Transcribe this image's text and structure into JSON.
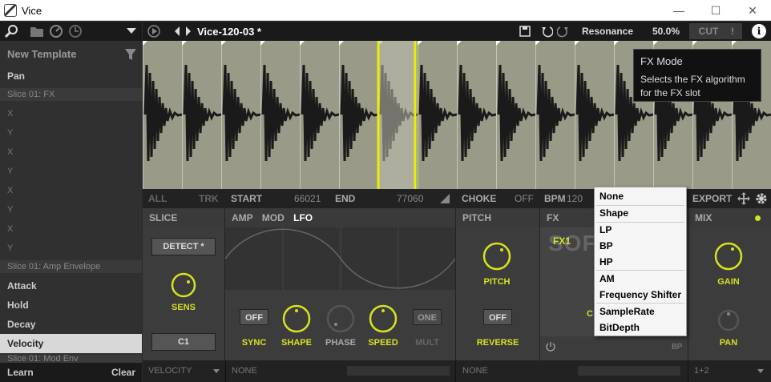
{
  "window": {
    "title": "Vice",
    "min": "—",
    "max": "☐",
    "close": "✕"
  },
  "sidebar": {
    "template": "New Template",
    "pan": "Pan",
    "sec1": "Slice 01: FX",
    "xy": [
      "X",
      "Y",
      "X",
      "Y",
      "X",
      "Y",
      "X",
      "Y"
    ],
    "sec2": "Slice 01: Amp Envelope",
    "env": [
      "Attack",
      "Hold",
      "Decay",
      "Velocity"
    ],
    "sec3": "Slice 01: Mod Env",
    "learn": "Learn",
    "clear": "Clear"
  },
  "topbar": {
    "preset": "Vice-120-03 *",
    "param": "Resonance",
    "value": "50.0%",
    "cut": "CUT",
    "excl": "!",
    "info": "i"
  },
  "ctrlbar": {
    "all": "ALL",
    "trk": "TRK",
    "start": "START",
    "start_val": "66021",
    "end": "END",
    "end_val": "77060",
    "choke": "CHOKE",
    "choke_val": "OFF",
    "bpm": "BPM",
    "bpm_val": "120",
    "export": "EXPORT"
  },
  "panels": {
    "slice": {
      "title": "SLICE",
      "detect": "DETECT *",
      "sens": "SENS",
      "note": "C1"
    },
    "amp": {
      "amp": "AMP",
      "mod": "MOD",
      "lfo": "LFO",
      "sync_btn": "OFF",
      "one": "ONE",
      "sync": "SYNC",
      "shape": "SHAPE",
      "phase": "PHASE",
      "speed": "SPEED",
      "mult": "MULT"
    },
    "pitch": {
      "title": "PITCH",
      "pitch": "PITCH",
      "rev_btn": "OFF",
      "reverse": "REVERSE"
    },
    "fx": {
      "title": "FX",
      "fx1": "FX1",
      "c": "C",
      "bp": "BP"
    },
    "mix": {
      "title": "MIX",
      "gain": "GAIN",
      "pan": "PAN"
    }
  },
  "footer": {
    "velocity": "VELOCITY",
    "none1": "NONE",
    "none2": "NONE",
    "route": "1+2"
  },
  "menu": {
    "items": [
      "None",
      "Shape",
      "LP",
      "BP",
      "HP",
      "AM",
      "Frequency Shifter",
      "SampleRate",
      "BitDepth"
    ]
  },
  "tooltip": {
    "title": "FX Mode",
    "body1": "Selects the FX algorithm",
    "body2": "for the FX slot"
  },
  "watermark": "SOFTPEDIA",
  "colors": {
    "accent": "#d7e021"
  }
}
